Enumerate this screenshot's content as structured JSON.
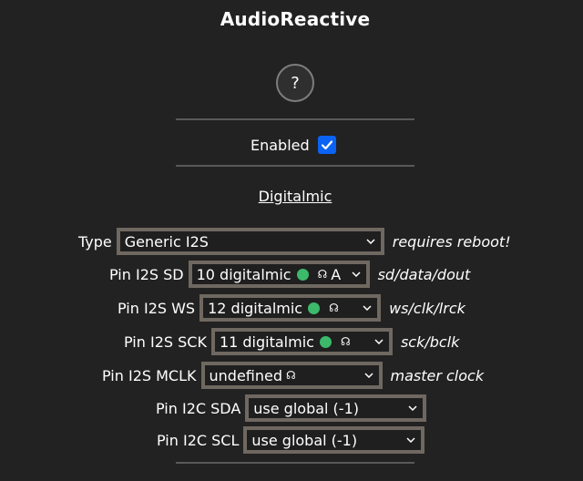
{
  "page": {
    "title": "AudioReactive"
  },
  "help": {
    "label": "?"
  },
  "enabled": {
    "label": "Enabled",
    "checked": true
  },
  "section": {
    "title": "Digitalmic"
  },
  "rows": [
    {
      "label": "Type",
      "value": "Generic I2S",
      "note": "requires reboot!"
    },
    {
      "label": "Pin I2S SD",
      "value": "10 digitalmic",
      "suffix": "A",
      "note": "sd/data/dout"
    },
    {
      "label": "Pin I2S WS",
      "value": "12 digitalmic",
      "note": "ws/clk/lrck"
    },
    {
      "label": "Pin I2S SCK",
      "value": "11 digitalmic",
      "note": "sck/bclk"
    },
    {
      "label": "Pin I2S MCLK",
      "value": "undefined",
      "note": "master clock"
    },
    {
      "label": "Pin I2C SDA",
      "value": "use global (-1)"
    },
    {
      "label": "Pin I2C SCL",
      "value": "use global (-1)"
    }
  ],
  "icons": {
    "in_use_dot": "green-circle-icon",
    "headphone": "headphone-icon",
    "chevron": "chevron-down-icon"
  },
  "colors": {
    "accent": "#0a63f2",
    "dot": "#3cb96a",
    "border": "#6f6861"
  }
}
